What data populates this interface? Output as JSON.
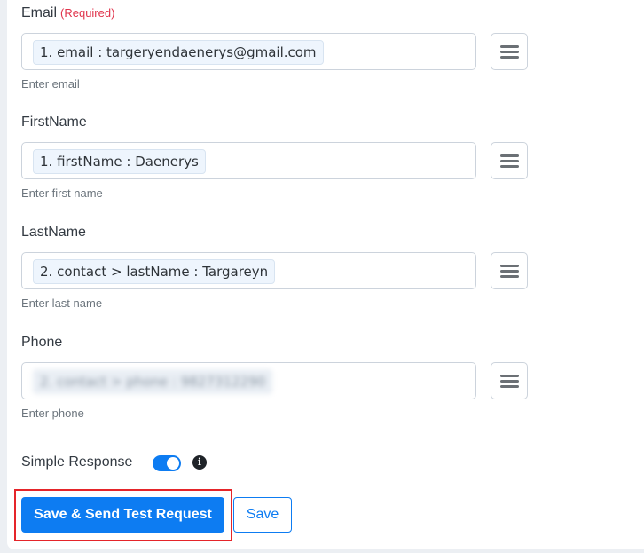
{
  "form": {
    "fields": [
      {
        "label": "Email",
        "required_text": "(Required)",
        "value": "1. email : targeryendaenerys@gmail.com",
        "hint": "Enter email",
        "menu_icon": "hamburger-menu-icon"
      },
      {
        "label": "FirstName",
        "value": "1. firstName : Daenerys",
        "hint": "Enter first name",
        "menu_icon": "hamburger-menu-icon"
      },
      {
        "label": "LastName",
        "value": "2. contact > lastName : Targareyn",
        "hint": "Enter last name",
        "menu_icon": "hamburger-menu-icon"
      },
      {
        "label": "Phone",
        "value": "2. contact > phone : 9827312290",
        "value_redacted": true,
        "hint": "Enter phone",
        "menu_icon": "hamburger-menu-icon"
      }
    ],
    "simple_response": {
      "label": "Simple Response",
      "enabled": true,
      "info_icon": "info-circle-icon",
      "info_glyph": "i"
    }
  },
  "actions": {
    "save_and_send_label": "Save & Send Test Request",
    "save_label": "Save"
  },
  "colors": {
    "accent": "#0d7cf2",
    "required": "#e0334b",
    "highlight": "#e5252a"
  }
}
